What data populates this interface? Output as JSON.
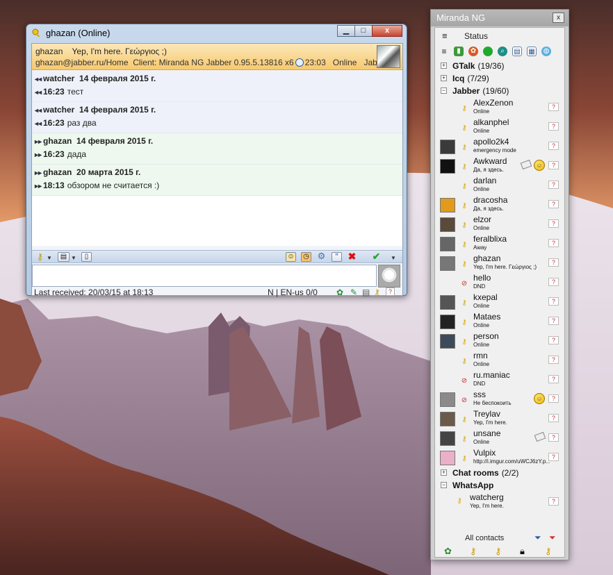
{
  "chat_window": {
    "title": "ghazan (Online)",
    "controls": {
      "minimize": "▁",
      "maximize": "□",
      "close": "x"
    },
    "info": {
      "name": "ghazan",
      "status_message": "Yep, I'm here. Γεώργιος ;)",
      "jid": "ghazan@jabber.ru/Home",
      "client": "Client: Miranda NG Jabber 0.95.5.13816 x6",
      "time": "23:03",
      "status": "Online",
      "protocol": "Jabber"
    },
    "messages": [
      {
        "direction": "in",
        "author": "watcher",
        "date": "14 февраля 2015 г.",
        "time": "16:23",
        "text": "тест"
      },
      {
        "direction": "in",
        "author": "watcher",
        "date": "14 февраля 2015 г.",
        "time": "16:23",
        "text": "раз два"
      },
      {
        "direction": "out",
        "author": "ghazan",
        "date": "14 февраля 2015 г.",
        "time": "16:23",
        "text": "дада"
      },
      {
        "direction": "out",
        "author": "ghazan",
        "date": "20 марта 2015 г.",
        "time": "18:13",
        "text": "обзором не считается :)"
      }
    ],
    "input_value": "",
    "status_bar": {
      "last_received": "Last received: 20/03/15 at 18:13",
      "mode": "N | EN-us 0/0"
    }
  },
  "miranda": {
    "title": "Miranda NG",
    "close": "x",
    "menu_icon": "≡",
    "status_label": "Status",
    "groups": [
      {
        "name": "GTalk",
        "count": "(19/36)",
        "expanded": false
      },
      {
        "name": "Icq",
        "count": "(7/29)",
        "expanded": false
      },
      {
        "name": "Jabber",
        "count": "(19/60)",
        "expanded": true
      },
      {
        "name": "Chat rooms",
        "count": "(2/2)",
        "expanded": false
      },
      {
        "name": "WhatsApp",
        "count": "",
        "expanded": true
      }
    ],
    "jabber_contacts": [
      {
        "name": "AlexZenon",
        "status": "Online",
        "state": "on",
        "avatar": ""
      },
      {
        "name": "alkanphel",
        "status": "Online",
        "state": "on",
        "avatar": ""
      },
      {
        "name": "apollo2k4",
        "status": "emergency mode",
        "state": "on",
        "avatar": "#3a3a3a"
      },
      {
        "name": "Awkward",
        "status": "Да, я здесь.",
        "state": "on",
        "avatar": "#111"
      },
      {
        "name": "darlan",
        "status": "Online",
        "state": "on",
        "avatar": ""
      },
      {
        "name": "dracosha",
        "status": "Да, я здесь.",
        "state": "on",
        "avatar": "#e19a1c"
      },
      {
        "name": "elzor",
        "status": "Online",
        "state": "on",
        "avatar": "#5a4a3a"
      },
      {
        "name": "feralblixa",
        "status": "Away",
        "state": "away",
        "avatar": "#666"
      },
      {
        "name": "ghazan",
        "status": "Yep, I'm here. Γεώργιος ;)",
        "state": "on",
        "avatar": "#777"
      },
      {
        "name": "hello",
        "status": "DND",
        "state": "dnd",
        "avatar": ""
      },
      {
        "name": "kxepal",
        "status": "Online",
        "state": "on",
        "avatar": "#555"
      },
      {
        "name": "Mataes",
        "status": "Online",
        "state": "on",
        "avatar": "#222"
      },
      {
        "name": "person",
        "status": "Online",
        "state": "on",
        "avatar": "#3d4a5a"
      },
      {
        "name": "rmn",
        "status": "Online",
        "state": "on",
        "avatar": ""
      },
      {
        "name": "ru.maniac",
        "status": "DND",
        "state": "dnd",
        "avatar": ""
      },
      {
        "name": "sss",
        "status": "Не беспокоить",
        "state": "dnd",
        "avatar": "#8a8a8a"
      },
      {
        "name": "Treylav",
        "status": "Yep, I'm here.",
        "state": "on",
        "avatar": "#6b5a4a"
      },
      {
        "name": "unsane",
        "status": "Online",
        "state": "on",
        "avatar": "#444"
      },
      {
        "name": "Vulpix",
        "status": "http://i.imgur.com/uWCJ6zY.p...",
        "state": "on",
        "avatar": "#e9b0c7"
      }
    ],
    "whatsapp_contacts": [
      {
        "name": "watcherg",
        "status": "Yep, I'm here.",
        "state": "on"
      }
    ],
    "footer_label": "All contacts"
  }
}
